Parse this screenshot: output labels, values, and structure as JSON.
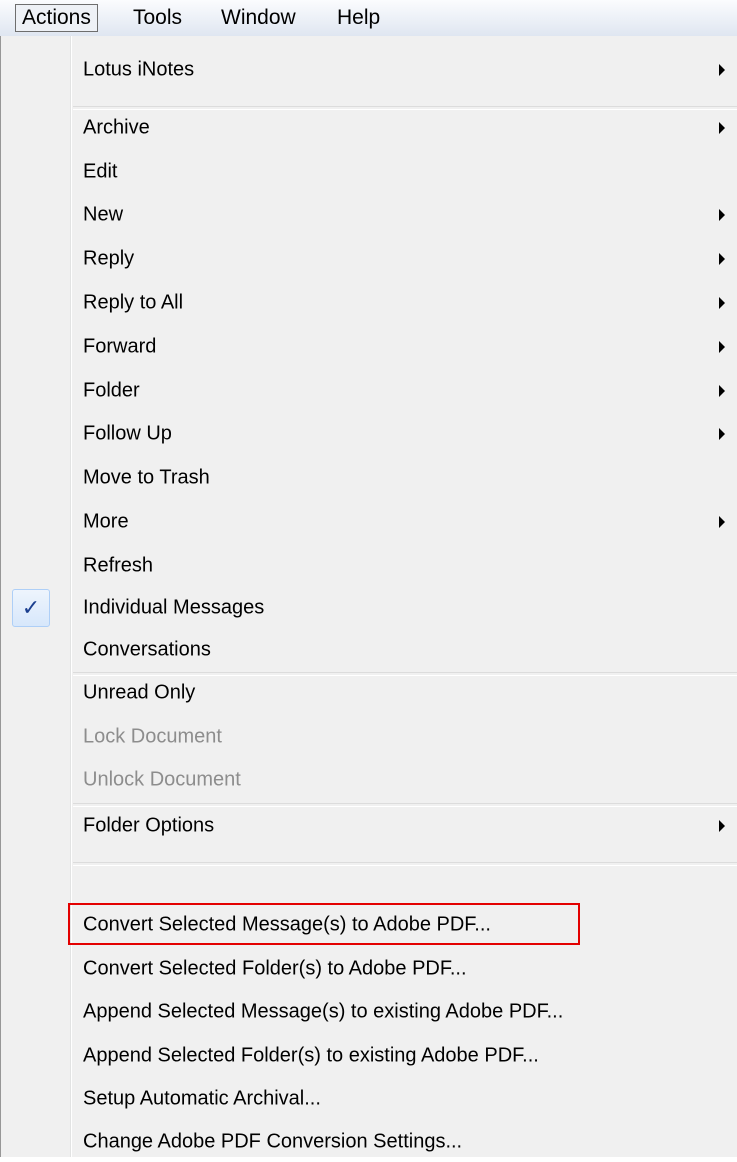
{
  "menubar": {
    "items": [
      {
        "label": "Actions",
        "active": true
      },
      {
        "label": "Tools"
      },
      {
        "label": "Window"
      },
      {
        "label": "Help"
      }
    ]
  },
  "menu": {
    "items": [
      {
        "label": "Lotus iNotes",
        "submenu": true
      },
      {
        "label": "Archive",
        "submenu": true
      },
      {
        "label": "Edit"
      },
      {
        "label": "New",
        "submenu": true
      },
      {
        "label": "Reply",
        "submenu": true
      },
      {
        "label": "Reply to All",
        "submenu": true
      },
      {
        "label": "Forward",
        "submenu": true
      },
      {
        "label": "Folder",
        "submenu": true
      },
      {
        "label": "Follow Up",
        "submenu": true
      },
      {
        "label": "Move to Trash"
      },
      {
        "label": "More",
        "submenu": true
      },
      {
        "label": "Refresh"
      },
      {
        "label": "Individual Messages",
        "checked": true
      },
      {
        "label": "Conversations"
      },
      {
        "label": "Unread Only"
      },
      {
        "label": "Lock Document",
        "disabled": true
      },
      {
        "label": "Unlock Document",
        "disabled": true
      },
      {
        "label": "Folder Options",
        "submenu": true
      },
      {
        "label": "Convert Selected Message(s) to Adobe PDF...",
        "highlighted": true
      },
      {
        "label": "Convert Selected Folder(s) to Adobe PDF..."
      },
      {
        "label": "Append Selected Message(s) to existing Adobe PDF..."
      },
      {
        "label": "Append Selected Folder(s) to existing Adobe PDF..."
      },
      {
        "label": "Setup Automatic Archival..."
      },
      {
        "label": "Change Adobe PDF Conversion Settings..."
      }
    ],
    "check_glyph": "✓"
  },
  "colors": {
    "highlight_border": "#e30000",
    "disabled_text": "#8d8d8d",
    "check_color": "#1b3f8f"
  }
}
